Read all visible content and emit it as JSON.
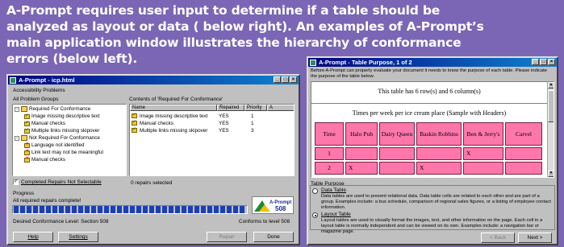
{
  "slide": {
    "title": "A-Prompt requires user input to determine if a table should be analyzed as layout or data ( below right).  An examples of A-Prompt’s main application window illustrates the hierarchy of conformance errors (below left)."
  },
  "main_window": {
    "title": "A-Prompt - icp.html",
    "groupbox_title": "Accessibility Problems",
    "left_pane_header": "All Problem Groups",
    "right_pane_header": "Contents of 'Required For Conformance'",
    "tree": [
      {
        "label": "Required For Conformance",
        "level": 0,
        "icon": "folder-icon"
      },
      {
        "label": "Image missing descriptive text",
        "level": 1,
        "icon": "check-icon"
      },
      {
        "label": "Manual checks",
        "level": 1,
        "icon": "check-icon"
      },
      {
        "label": "Multiple links missing skipover",
        "level": 1,
        "icon": "check-icon"
      },
      {
        "label": "Not Required For Conformance",
        "level": 0,
        "icon": "folder-icon"
      },
      {
        "label": "Language not identified",
        "level": 1,
        "icon": "error-icon"
      },
      {
        "label": "Link text may not be meaningful",
        "level": 1,
        "icon": "error-icon"
      },
      {
        "label": "Manual checks",
        "level": 1,
        "icon": "error-icon"
      }
    ],
    "columns": [
      "Name",
      "Repaired",
      "Priority",
      "A"
    ],
    "rows": [
      {
        "name": "Image missing descriptive text",
        "repaired": "YES",
        "priority": "1"
      },
      {
        "name": "Manual checks",
        "repaired": "YES",
        "priority": "1"
      },
      {
        "name": "Multiple links missing skipover",
        "repaired": "YES",
        "priority": "3"
      }
    ],
    "checkbox_label": "Completed Repairs Not Selectable",
    "repairs_selected": "0 repairs selected",
    "progress_title": "Progress",
    "progress_text": "All required repairs complete!",
    "progress_fraction": 1.0,
    "logo_text_top": "A-Prompt",
    "logo_text_bottom": "508",
    "desired_level": "Desired Conformance Level: Section 508",
    "conforms_to": "Conforms to level 508",
    "buttons": {
      "help": "Help",
      "settings": "Settings",
      "repair": "Repair",
      "done": "Done"
    }
  },
  "table_window": {
    "title": "A-Prompt - Table Purpose, 1 of 2",
    "intro": "Before A-Prompt can properly evaluate your document it needs to know the purpose of each table. Please indicate the purpose of the table below.",
    "table_info": "This table has 6 row(s) and 6 column(s)",
    "caption": "Times per week per ice cream place (Sample with Headers)",
    "headers": [
      "Time",
      "Halo Pub",
      "Dairy Queen",
      "Baskin Robbins",
      "Ben & Jerry's",
      "Carvel"
    ],
    "row1": [
      "1",
      "",
      "",
      "",
      "X",
      ""
    ],
    "row2": [
      "2",
      "X",
      "",
      "X",
      "",
      ""
    ],
    "purpose_title": "Table Purpose",
    "data_option": "Data Table",
    "data_desc": "Data tables are used to present relational data. Data table cells are related to each other and are part of a group.  Examples include: a bus schedule, comparison of regional sales figures, or a listing of employee contact information.",
    "layout_option": "Layout Table",
    "layout_desc": "Layout tables are used to visually format the images, text, and other information on the page. Each cell in a layout table is normally independent and can be viewed on its own. Examples include: a navigation bar or magazine page.",
    "selected": "layout",
    "buttons": {
      "back": "< Back",
      "next": "Next >"
    }
  }
}
